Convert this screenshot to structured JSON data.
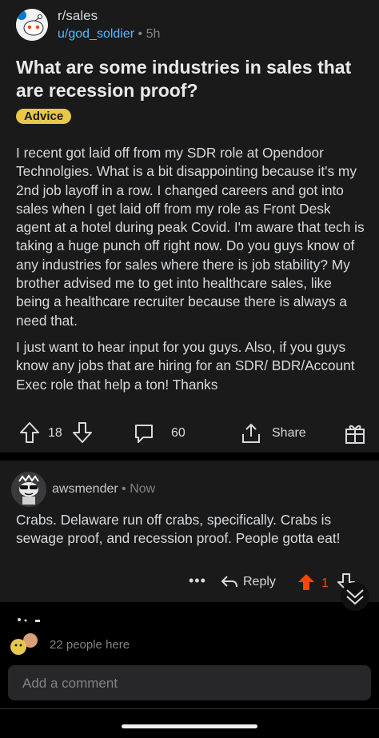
{
  "post": {
    "subreddit": "r/sales",
    "author": "u/god_soldier",
    "separator": "•",
    "age": "5h",
    "title": "What are some industries in sales that are recession proof?",
    "flair": "Advice",
    "flair_color": "#e8c84a",
    "body": [
      "I recent got laid off from my SDR role at Opendoor Technolgies. What is a bit disappointing because it's my 2nd job layoff in a row. I changed careers and got into sales when I get laid off from my role as Front Desk agent at a hotel during peak Covid.  I'm aware that tech is taking a huge punch off right now. Do you guys know of any industries for sales where there is job stability? My brother advised me to get into healthcare sales, like being a healthcare recruiter because there is always a need that.",
      "I just want to hear input for you guys. Also, if you guys know any jobs that are hiring for an SDR/ BDR/Account Exec role that help a ton! Thanks"
    ],
    "actions": {
      "upvote_icon": "arrow-up-outline-icon",
      "score": "18",
      "downvote_icon": "arrow-down-outline-icon",
      "comment_icon": "speech-bubble-icon",
      "comments": "60",
      "share_icon": "share-upload-icon",
      "share_label": "Share",
      "award_icon": "gift-award-icon"
    }
  },
  "comment": {
    "author": "awsmender",
    "separator": "•",
    "age": "Now",
    "text": "Crabs. Delaware run off crabs, specifically. Crabs is sewage proof, and recession proof. People gotta eat!",
    "more_icon": "ellipsis-icon",
    "reply_label": "Reply",
    "score": "1",
    "upvote_color": "#ff4500"
  },
  "footer": {
    "people_here": "22 people here",
    "add_comment_placeholder": "Add a comment"
  }
}
